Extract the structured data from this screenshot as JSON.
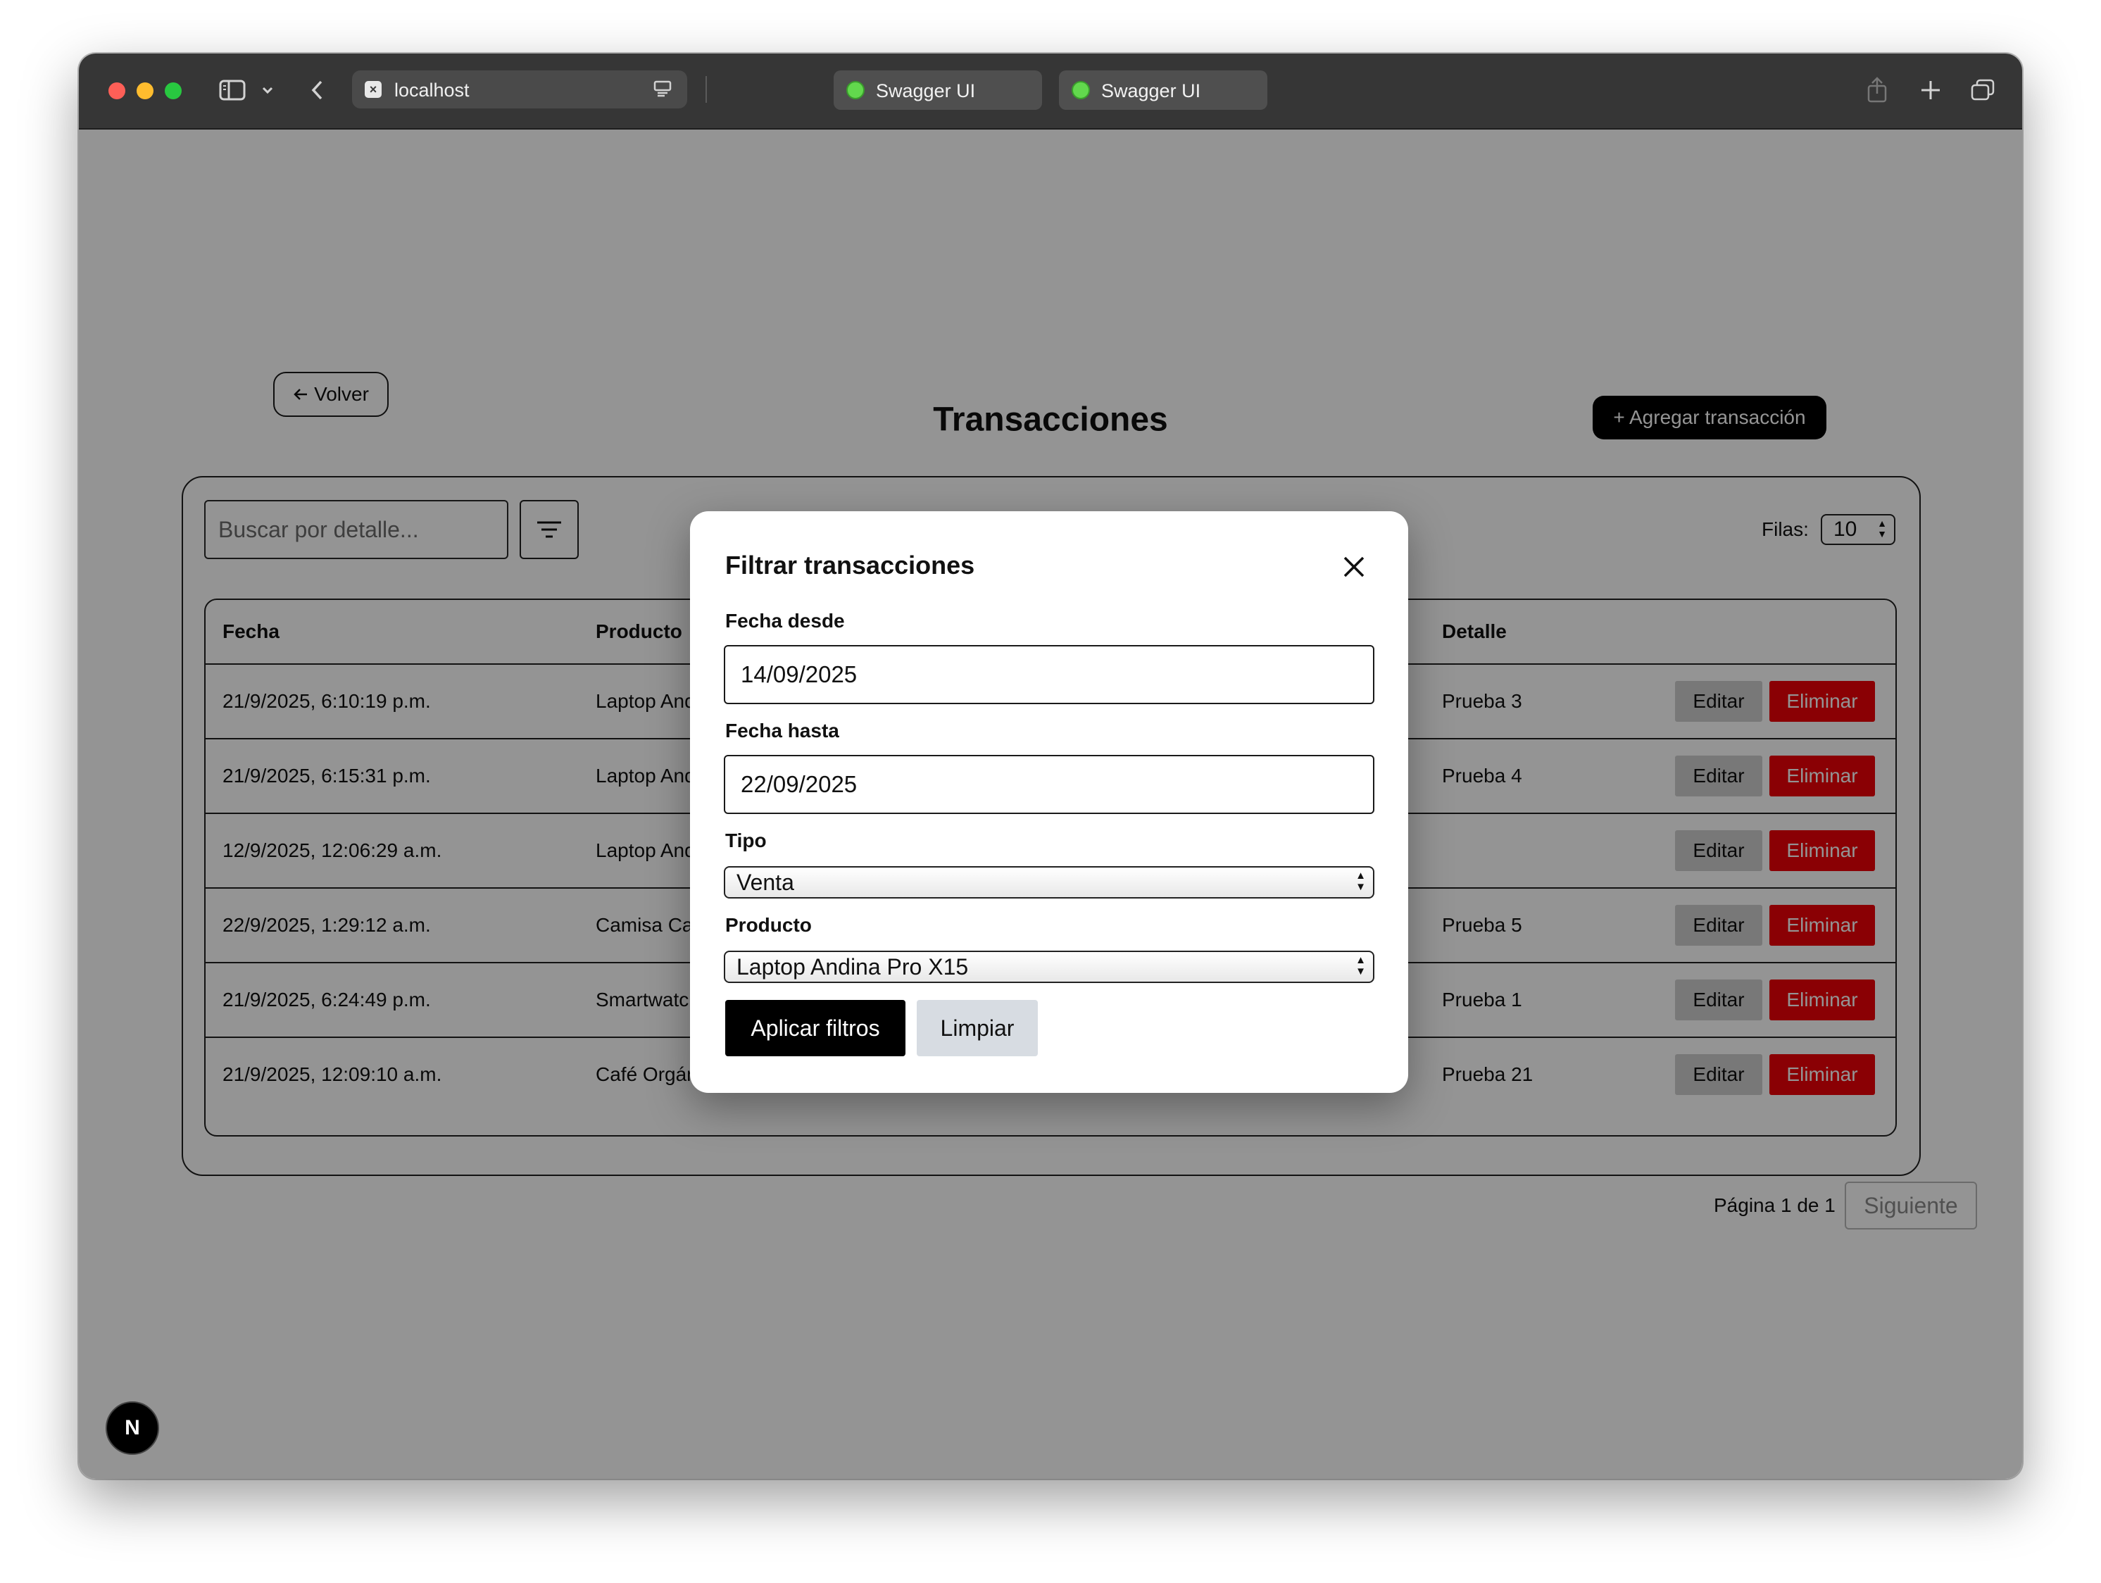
{
  "browser": {
    "url_tab": "localhost",
    "tabs": [
      {
        "label": "Swagger UI"
      },
      {
        "label": "Swagger UI"
      }
    ]
  },
  "page": {
    "back_label": "Volver",
    "title": "Transacciones",
    "add_label": "+ Agregar transacción",
    "search_placeholder": "Buscar por detalle...",
    "rows_label": "Filas:",
    "rows_value": "10",
    "columns": [
      "Fecha",
      "Producto",
      "Detalle"
    ],
    "rows": [
      {
        "fecha": "21/9/2025, 6:10:19 p.m.",
        "producto": "Laptop Andina Pro X15",
        "detalle": "Prueba 3"
      },
      {
        "fecha": "21/9/2025, 6:15:31 p.m.",
        "producto": "Laptop Andina Pro X15",
        "detalle": "Prueba 4"
      },
      {
        "fecha": "12/9/2025, 12:06:29 a.m.",
        "producto": "Laptop Andina Pro X15",
        "detalle": ""
      },
      {
        "fecha": "22/9/2025, 1:29:12 a.m.",
        "producto": "Camisa Casual",
        "detalle": "Prueba 5"
      },
      {
        "fecha": "21/9/2025, 6:24:49 p.m.",
        "producto": "Smartwatch",
        "detalle": "Prueba 1"
      },
      {
        "fecha": "21/9/2025, 12:09:10 a.m.",
        "producto": "Café Orgánico",
        "detalle": "Prueba 21"
      }
    ],
    "edit_label": "Editar",
    "delete_label": "Eliminar",
    "pagination": "Página 1 de 1",
    "next_label": "Siguiente"
  },
  "modal": {
    "title": "Filtrar transacciones",
    "fecha_desde_label": "Fecha desde",
    "fecha_desde_value": "14/09/2025",
    "fecha_hasta_label": "Fecha hasta",
    "fecha_hasta_value": "22/09/2025",
    "tipo_label": "Tipo",
    "tipo_value": "Venta",
    "producto_label": "Producto",
    "producto_value": "Laptop Andina Pro X15",
    "apply_label": "Aplicar filtros",
    "clear_label": "Limpiar"
  },
  "colors": {
    "accent_dark": "#000000",
    "danger": "#ee0008",
    "secondary": "#cfcfcf",
    "overlay": "rgba(0,0,0,0.42)"
  },
  "icons": {
    "dev_badge_letter": "N"
  }
}
